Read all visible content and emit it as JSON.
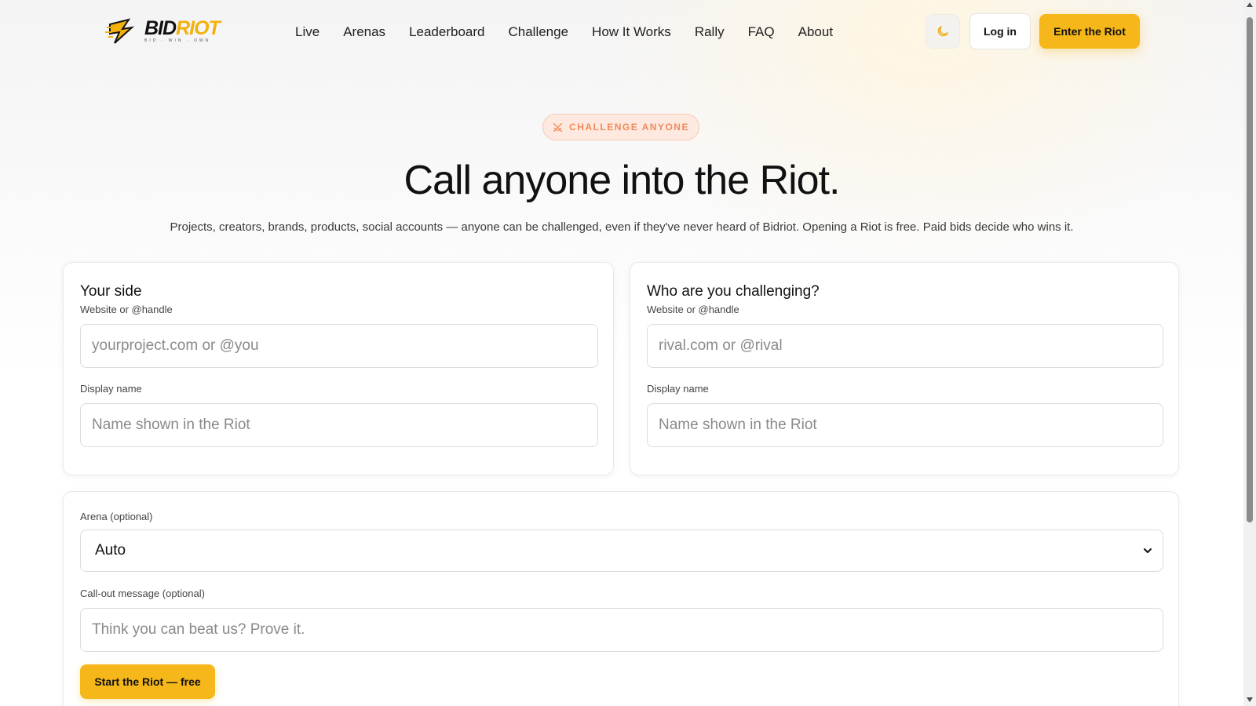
{
  "header": {
    "logo": {
      "word_dark": "BID",
      "word_accent": "RIOT",
      "tagline": "BID · WIN · OWN"
    },
    "nav": [
      "Live",
      "Arenas",
      "Leaderboard",
      "Challenge",
      "How It Works",
      "Rally",
      "FAQ",
      "About"
    ],
    "theme_icon": "moon-icon",
    "login_label": "Log in",
    "enter_label": "Enter the Riot"
  },
  "hero": {
    "badge_icon": "crossed-swords-icon",
    "badge": "CHALLENGE ANYONE",
    "title": "Call anyone into the Riot.",
    "subtitle": "Projects, creators, brands, products, social accounts — anyone can be challenged, even if they've never heard of Bidriot. Opening a Riot is free. Paid bids decide who wins it."
  },
  "your_side": {
    "title": "Your side",
    "website_label": "Website or @handle",
    "website_placeholder": "yourproject.com or @you",
    "display_label": "Display name",
    "display_placeholder": "Name shown in the Riot"
  },
  "challenger": {
    "title": "Who are you challenging?",
    "website_label": "Website or @handle",
    "website_placeholder": "rival.com or @rival",
    "display_label": "Display name",
    "display_placeholder": "Name shown in the Riot"
  },
  "details": {
    "arena_label": "Arena (optional)",
    "arena_value": "Auto",
    "message_label": "Call-out message (optional)",
    "message_placeholder": "Think you can beat us? Prove it.",
    "start_label": "Start the Riot — free"
  },
  "colors": {
    "accent": "#f5b719",
    "badge_text": "#ef8a5c",
    "badge_bg": "#fde9df"
  }
}
